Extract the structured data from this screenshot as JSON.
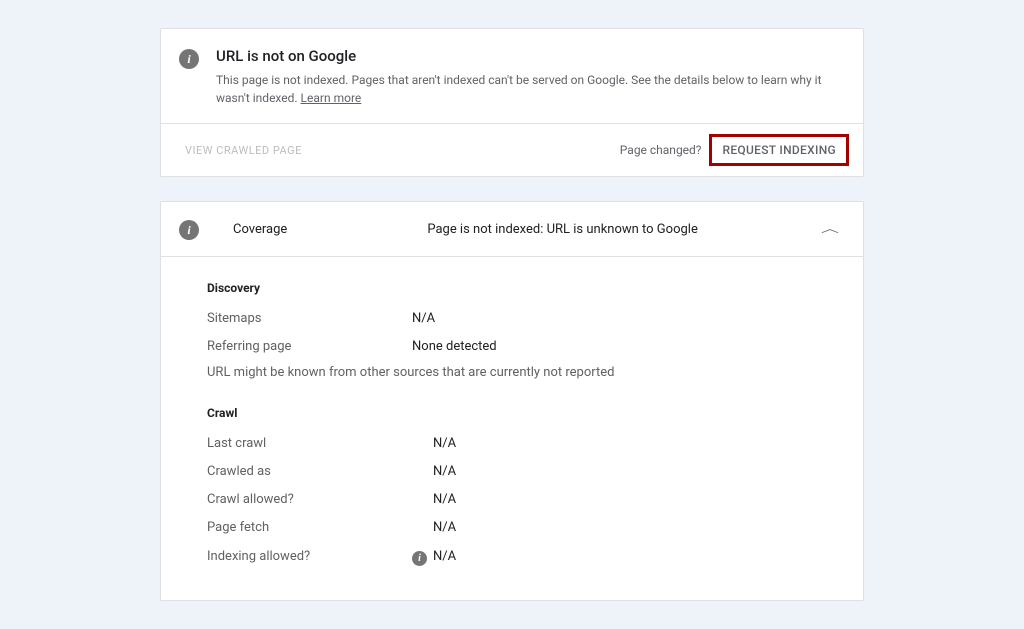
{
  "header": {
    "title": "URL is not on Google",
    "description": "This page is not indexed. Pages that aren't indexed can't be served on Google. See the details below to learn why it wasn't indexed.",
    "learn_more": "Learn more"
  },
  "actions": {
    "view_crawled": "VIEW CRAWLED PAGE",
    "page_changed": "Page changed?",
    "request_indexing": "REQUEST INDEXING"
  },
  "coverage": {
    "label": "Coverage",
    "summary": "Page is not indexed: URL is unknown to Google"
  },
  "discovery": {
    "title": "Discovery",
    "sitemaps_label": "Sitemaps",
    "sitemaps_value": "N/A",
    "referring_label": "Referring page",
    "referring_value": "None detected",
    "note": "URL might be known from other sources that are currently not reported"
  },
  "crawl": {
    "title": "Crawl",
    "last_crawl_label": "Last crawl",
    "last_crawl_value": "N/A",
    "crawled_as_label": "Crawled as",
    "crawled_as_value": "N/A",
    "crawl_allowed_label": "Crawl allowed?",
    "crawl_allowed_value": "N/A",
    "page_fetch_label": "Page fetch",
    "page_fetch_value": "N/A",
    "indexing_allowed_label": "Indexing allowed?",
    "indexing_allowed_value": "N/A"
  }
}
